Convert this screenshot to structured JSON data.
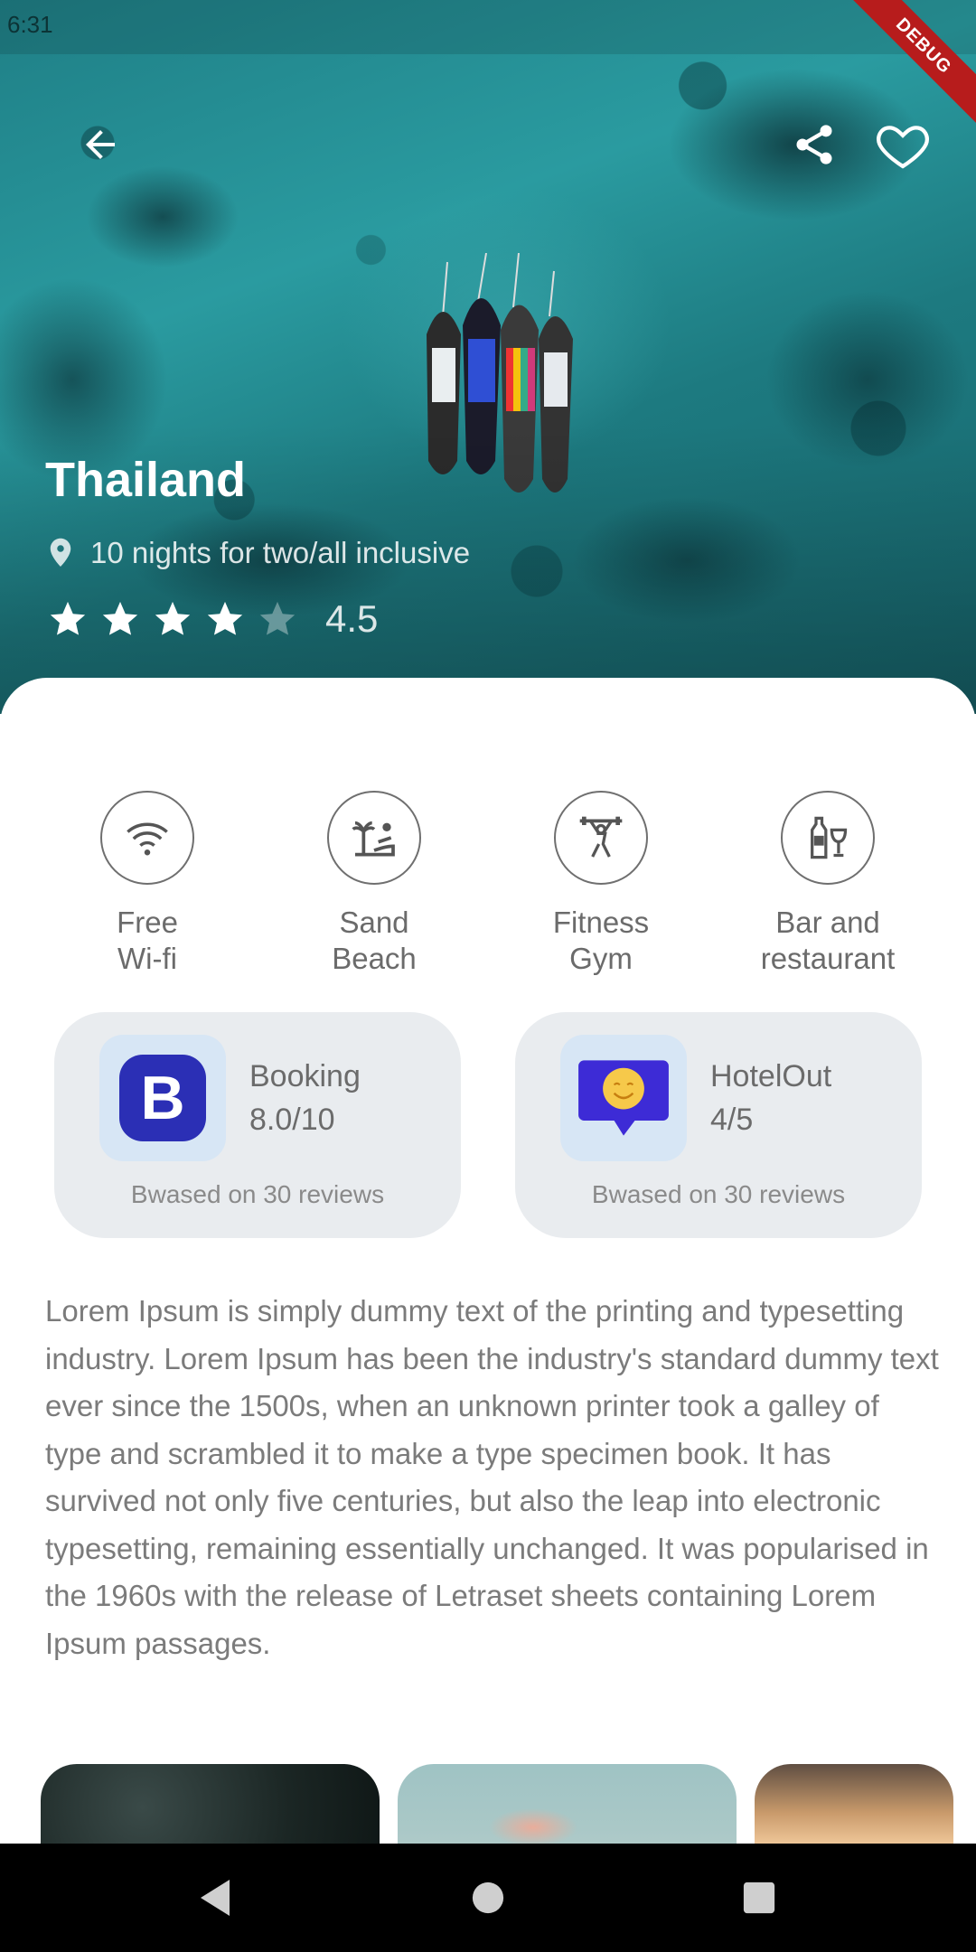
{
  "status_bar": {
    "time": "6:31"
  },
  "debug_banner": "DEBUG",
  "hero": {
    "title": "Thailand",
    "subtitle": "10 nights for two/all inclusive",
    "rating": {
      "stars": 4.5,
      "max": 5,
      "value": "4.5"
    },
    "icons": [
      "arrow-back-icon",
      "share-icon",
      "heart-outline-icon",
      "location-pin-icon",
      "star-icon"
    ]
  },
  "amenities": [
    {
      "label": "Free\nWi-fi",
      "icon": "wifi-icon"
    },
    {
      "label": "Sand\nBeach",
      "icon": "beach-icon"
    },
    {
      "label": "Fitness\nGym",
      "icon": "fitness-icon"
    },
    {
      "label": "Bar and\nrestaurant",
      "icon": "bar-icon"
    }
  ],
  "reviews": [
    {
      "name": "Booking",
      "score": "8.0/10",
      "note": "Bwased on 30 reviews",
      "logo": "booking-logo-icon"
    },
    {
      "name": "HotelOut",
      "score": "4/5",
      "note": "Bwased on 30 reviews",
      "logo": "hotelout-logo-icon"
    }
  ],
  "description": "Lorem Ipsum is simply dummy text of the printing and typesetting industry. Lorem Ipsum has been the industry's standard dummy text ever since the 1500s, when an unknown printer took a galley of type and scrambled it to make a type specimen book. It has survived not only five centuries, but also the leap into electronic typesetting, remaining essentially unchanged. It was popularised in the 1960s with the release of Letraset sheets containing Lorem Ipsum passages.",
  "colors": {
    "accent_text": "#6b6b6b",
    "card_bg": "#e9ecef",
    "logo_bg": "#d7e6f5",
    "booking_blue": "#2b2fb5",
    "hotelout_blue": "#3d2bd6"
  },
  "nav_bar": {
    "icons": [
      "nav-back-icon",
      "nav-home-icon",
      "nav-recent-icon"
    ]
  }
}
